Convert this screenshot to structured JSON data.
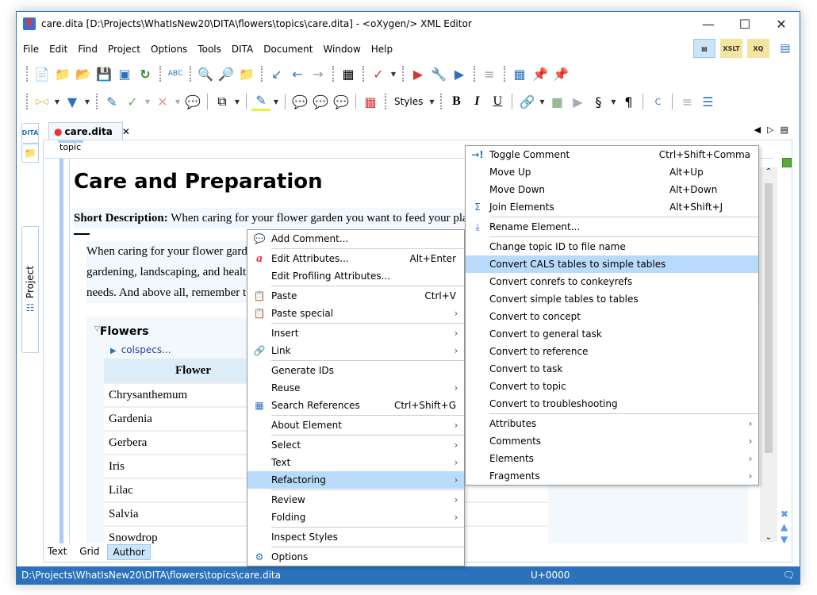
{
  "window": {
    "title": "care.dita [D:\\Projects\\WhatIsNew20\\DITA\\flowers\\topics\\care.dita] - <oXygen/> XML Editor",
    "controls": [
      "minimize",
      "maximize",
      "close"
    ]
  },
  "menubar": [
    "File",
    "Edit",
    "Find",
    "Project",
    "Options",
    "Tools",
    "DITA",
    "Document",
    "Window",
    "Help"
  ],
  "perspectives": [
    {
      "name": "editor-perspective-icon",
      "label": "",
      "active": true
    },
    {
      "name": "xslt-debugger-icon",
      "label": "XSLT",
      "active": false
    },
    {
      "name": "xquery-debugger-icon",
      "label": "XQ",
      "active": false
    },
    {
      "name": "database-perspective-icon",
      "label": "",
      "active": false
    }
  ],
  "toolbar2": {
    "styles_label": "Styles"
  },
  "sidebar": {
    "dita_label": "DITA",
    "project_label": "Project"
  },
  "editor_tab": {
    "label": "care.dita",
    "modified": true
  },
  "breadcrumb": "topic",
  "document": {
    "title": "Care and Preparation",
    "shortdesc_label": "Short Description:",
    "shortdesc_text": " When caring for your flower garden you want to feed your pla",
    "para_lines": [
      "When caring for your flower garde",
      "gardening, landscaping, and health",
      "needs. And above all, remember t"
    ],
    "section_title": "Flowers",
    "colspecs": "colspecs...",
    "table_header": "Flower",
    "table_rows": [
      "Chrysanthemum",
      "Gardenia",
      "Gerbera",
      "Iris",
      "Lilac",
      "Salvia",
      "Snowdrop"
    ]
  },
  "modes": [
    {
      "label": "Text",
      "active": false
    },
    {
      "label": "Grid",
      "active": false
    },
    {
      "label": "Author",
      "active": true
    }
  ],
  "status": {
    "path": "D:\\Projects\\WhatIsNew20\\DITA\\flowers\\topics\\care.dita",
    "unicode": "U+0000"
  },
  "context_menu": {
    "items": [
      {
        "label": "Add Comment...",
        "shortcut": "",
        "submenu": false,
        "icon": "add-comment"
      },
      {
        "label": "Edit Attributes...",
        "shortcut": "Alt+Enter",
        "submenu": false,
        "icon": "attributes"
      },
      {
        "label": "Edit Profiling Attributes...",
        "shortcut": "",
        "submenu": false,
        "icon": ""
      },
      {
        "label": "Paste",
        "shortcut": "Ctrl+V",
        "submenu": false,
        "icon": "paste"
      },
      {
        "label": "Paste special",
        "shortcut": "",
        "submenu": true,
        "icon": "paste-special"
      },
      {
        "label": "Insert",
        "shortcut": "",
        "submenu": true,
        "icon": ""
      },
      {
        "label": "Link",
        "shortcut": "",
        "submenu": true,
        "icon": "link"
      },
      {
        "label": "Generate IDs",
        "shortcut": "",
        "submenu": false,
        "icon": ""
      },
      {
        "label": "Reuse",
        "shortcut": "",
        "submenu": true,
        "icon": ""
      },
      {
        "label": "Search References",
        "shortcut": "Ctrl+Shift+G",
        "submenu": false,
        "icon": "search-references"
      },
      {
        "label": "About Element",
        "shortcut": "",
        "submenu": true,
        "icon": ""
      },
      {
        "label": "Select",
        "shortcut": "",
        "submenu": true,
        "icon": ""
      },
      {
        "label": "Text",
        "shortcut": "",
        "submenu": true,
        "icon": ""
      },
      {
        "label": "Refactoring",
        "shortcut": "",
        "submenu": true,
        "icon": "",
        "highlighted": true
      },
      {
        "label": "Review",
        "shortcut": "",
        "submenu": true,
        "icon": ""
      },
      {
        "label": "Folding",
        "shortcut": "",
        "submenu": true,
        "icon": ""
      },
      {
        "label": "Inspect Styles",
        "shortcut": "",
        "submenu": false,
        "icon": ""
      },
      {
        "label": "Options",
        "shortcut": "",
        "submenu": false,
        "icon": "options"
      }
    ]
  },
  "refactoring_menu": {
    "items": [
      {
        "label": "Toggle Comment",
        "shortcut": "Ctrl+Shift+Comma",
        "submenu": false
      },
      {
        "label": "Move Up",
        "shortcut": "Alt+Up",
        "submenu": false
      },
      {
        "label": "Move Down",
        "shortcut": "Alt+Down",
        "submenu": false
      },
      {
        "label": "Join Elements",
        "shortcut": "Alt+Shift+J",
        "submenu": false
      },
      {
        "label": "Rename Element...",
        "shortcut": "",
        "submenu": false
      },
      {
        "label": "Change topic ID to file name",
        "shortcut": "",
        "submenu": false
      },
      {
        "label": "Convert CALS tables to simple tables",
        "shortcut": "",
        "submenu": false,
        "highlighted": true
      },
      {
        "label": "Convert conrefs to conkeyrefs",
        "shortcut": "",
        "submenu": false
      },
      {
        "label": "Convert simple tables to tables",
        "shortcut": "",
        "submenu": false
      },
      {
        "label": "Convert to concept",
        "shortcut": "",
        "submenu": false
      },
      {
        "label": "Convert to general task",
        "shortcut": "",
        "submenu": false
      },
      {
        "label": "Convert to reference",
        "shortcut": "",
        "submenu": false
      },
      {
        "label": "Convert to task",
        "shortcut": "",
        "submenu": false
      },
      {
        "label": "Convert to topic",
        "shortcut": "",
        "submenu": false
      },
      {
        "label": "Convert to troubleshooting",
        "shortcut": "",
        "submenu": false
      },
      {
        "label": "Attributes",
        "shortcut": "",
        "submenu": true
      },
      {
        "label": "Comments",
        "shortcut": "",
        "submenu": true
      },
      {
        "label": "Elements",
        "shortcut": "",
        "submenu": true
      },
      {
        "label": "Fragments",
        "shortcut": "",
        "submenu": true
      }
    ]
  },
  "colors": {
    "accent": "#2c72bb",
    "highlight": "#b9dbfb",
    "status_green": "#5aab3a"
  }
}
